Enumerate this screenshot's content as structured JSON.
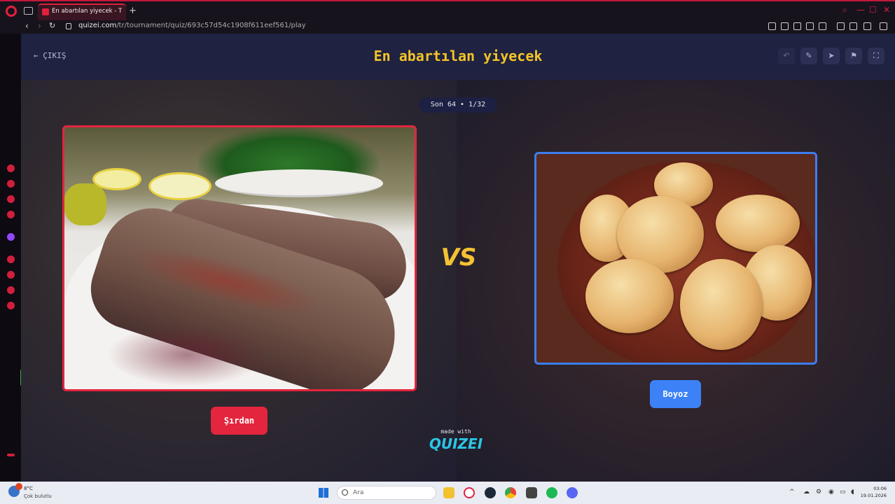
{
  "browser": {
    "tab_title": "En abartılan yiyecek - Ti",
    "url_domain": "quizei.com",
    "url_path": "/tr/tournament/quiz/693c57d54c1908f611eef561/play",
    "new_tab_icon": "plus-icon"
  },
  "header": {
    "exit_label": "ÇIKIŞ",
    "title": "En abartılan yiyecek",
    "actions": [
      "undo-icon",
      "edit-icon",
      "share-icon",
      "flag-icon",
      "fullscreen-icon"
    ]
  },
  "round": {
    "label": "Son 64 • 1/32"
  },
  "matchup": {
    "left_label": "Şırdan",
    "right_label": "Boyoz",
    "vs_label": "VS",
    "left_border_color": "#e3253e",
    "right_border_color": "#3c7ef0"
  },
  "branding": {
    "made_with": "made with",
    "brand": "QUIZEI"
  },
  "taskbar": {
    "weather_temp": "8°C",
    "weather_condition": "Çok bulutlu",
    "search_placeholder": "Ara",
    "time": "03:06",
    "date": "19.01.2026"
  }
}
